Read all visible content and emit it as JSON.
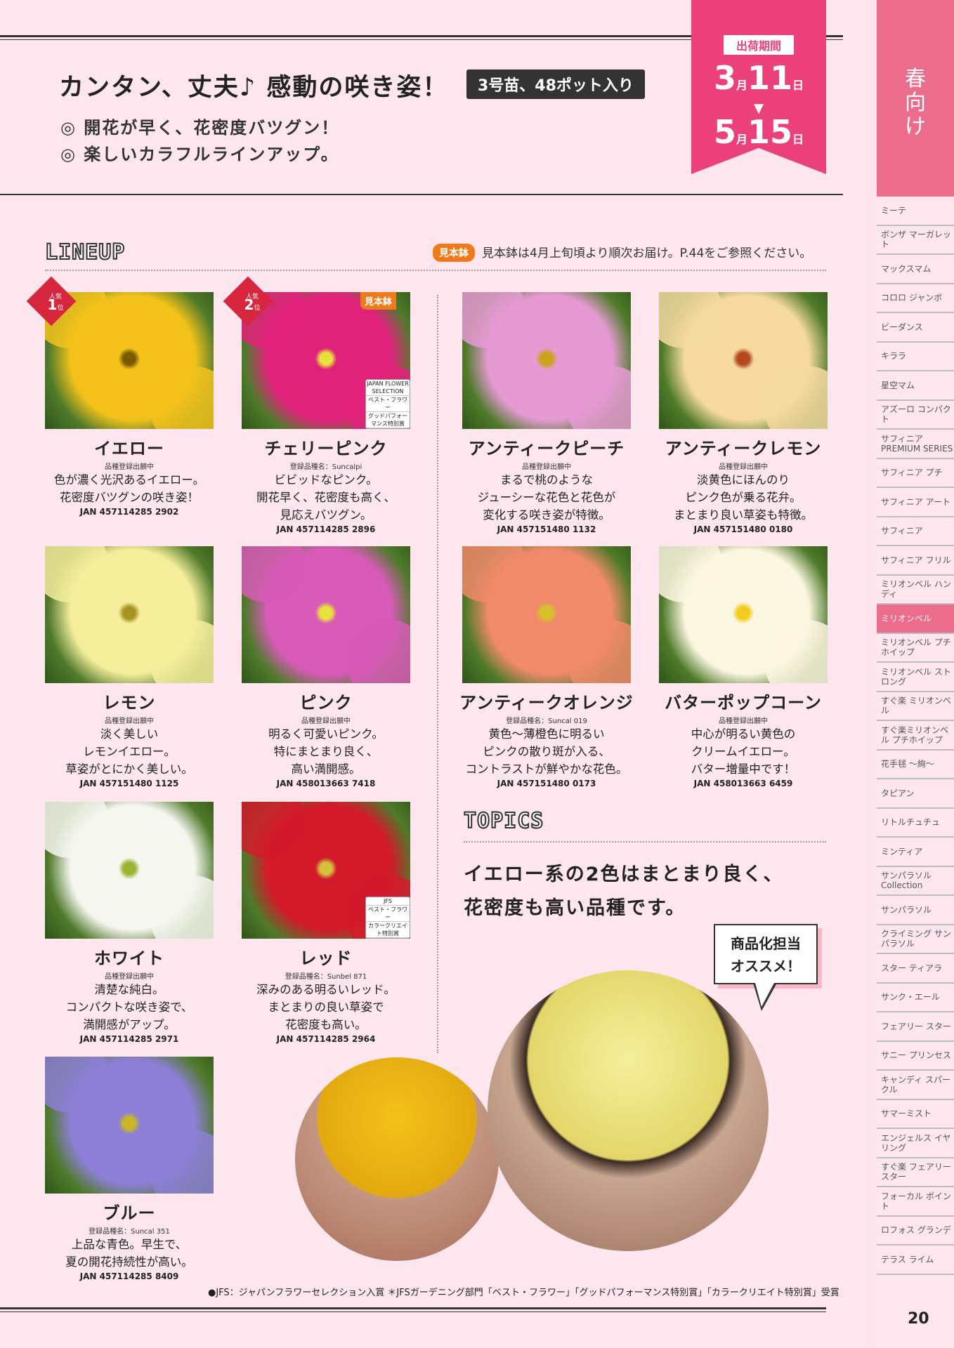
{
  "header": {
    "title": "カンタン、丈夫♪ 感動の咲き姿！",
    "pill": "3号苗、48ポット入り",
    "bullets": [
      "◎ 開花が早く、花密度バツグン！",
      "◎ 楽しいカラフルラインアップ。"
    ]
  },
  "shipping": {
    "label": "出荷期間",
    "start_month": "3",
    "start_day": "11",
    "end_month": "5",
    "end_day": "15",
    "month_unit": "月",
    "day_unit": "日",
    "arrow": "▼"
  },
  "lineup": {
    "heading": "LINEUP",
    "sample_badge": "見本鉢",
    "sample_note": "見本鉢は4月上旬頃より順次お届け。P.44をご参照ください。"
  },
  "rank": {
    "label": "人気",
    "unit": "位"
  },
  "products": [
    {
      "name": "イエロー",
      "reg": "品種登録出願中",
      "desc": [
        "色が濃く光沢あるイエロー。",
        "花密度バツグンの咲き姿！"
      ],
      "jan": "JAN 457114285 2902",
      "rank": "1",
      "color": "#f2c21b",
      "center": "#7a5a00"
    },
    {
      "name": "チェリーピンク",
      "reg": "登録品種名：Suncalpi",
      "desc": [
        "ビビッドなピンク。",
        "開花早く、花密度も高く、",
        "見応えバツグン。"
      ],
      "jan": "JAN 457114285 2896",
      "rank": "2",
      "badge": "見本鉢",
      "award": [
        "JAPAN FLOWER SELECTION",
        "ベスト・フラワー",
        "グッドパフォーマンス特別賞"
      ],
      "color": "#e0217a",
      "center": "#e8e23c"
    },
    {
      "name": "アンティークピーチ",
      "reg": "品種登録出願中",
      "desc": [
        "まるで桃のような",
        "ジューシーな花色と花色が",
        "変化する咲き姿が特徴。"
      ],
      "jan": "JAN 457151480 1132",
      "color": "#e59ad2",
      "center": "#c9a31c"
    },
    {
      "name": "アンティークレモン",
      "reg": "品種登録出願中",
      "desc": [
        "淡黄色にほんのり",
        "ピンク色が乗る花弁。",
        "まとまり良い草姿も特徴。"
      ],
      "jan": "JAN 457151480 0180",
      "color": "#f5d9a0",
      "center": "#b5461e"
    },
    {
      "name": "レモン",
      "reg": "品種登録出願中",
      "desc": [
        "淡く美しい",
        "レモンイエロー。",
        "草姿がとにかく美しい。"
      ],
      "jan": "JAN 457151480 1125",
      "color": "#f4ed9c",
      "center": "#a69420"
    },
    {
      "name": "ピンク",
      "reg": "品種登録出願中",
      "desc": [
        "明るく可愛いピンク。",
        "特にまとまり良く、",
        "高い満開感。"
      ],
      "jan": "JAN 458013663 7418",
      "color": "#d85bb7",
      "center": "#e8e23c"
    },
    {
      "name": "アンティークオレンジ",
      "reg": "登録品種名：Suncal 019",
      "desc": [
        "黄色〜薄橙色に明るい",
        "ピンクの散り斑が入る、",
        "コントラストが鮮やかな花色。"
      ],
      "jan": "JAN 457151480 0173",
      "color": "#f08a6a",
      "center": "#d8c02a"
    },
    {
      "name": "バターポップコーン",
      "reg": "品種登録出願中",
      "desc": [
        "中心が明るい黄色の",
        "クリームイエロー。",
        "バター増量中です！"
      ],
      "jan": "JAN 458013663 6459",
      "color": "#fbf6e0",
      "center": "#f2cc1a"
    },
    {
      "name": "ホワイト",
      "reg": "品種登録出願中",
      "desc": [
        "清楚な純白。",
        "コンパクトな咲き姿で、",
        "満開感がアップ。"
      ],
      "jan": "JAN 457114285 2971",
      "color": "#f6f6f0",
      "center": "#9bb532"
    },
    {
      "name": "レッド",
      "reg": "登録品種名：Sunbel 871",
      "desc": [
        "深みのある明るいレッド。",
        "まとまりの良い草姿で",
        "花密度も高い。"
      ],
      "jan": "JAN 457114285 2964",
      "award": [
        "JFS",
        "ベスト・フラワー",
        "カラークリエイト特別賞"
      ],
      "color": "#d21a2b",
      "center": "#d6c23a"
    },
    {
      "name": "ブルー",
      "reg": "登録品種名：Suncal 351",
      "desc": [
        "上品な青色。早生で、",
        "夏の開花持続性が高い。"
      ],
      "jan": "JAN 457114285 8409",
      "color": "#8d7fd6",
      "center": "#c9b625"
    }
  ],
  "topics": {
    "heading": "TOPICS",
    "lines": [
      "イエロー系の2色はまとまり良く、",
      "花密度も高い品種です。"
    ],
    "reco": [
      "商品化担当",
      "オススメ！"
    ]
  },
  "footnote": "●JFS：ジャパンフラワーセレクション入賞 ＊JFSガーデニング部門「ベスト・フラワー」「グッドパフォーマンス特別賞」「カラークリエイト特別賞」受賞",
  "sidebar": {
    "head": [
      "春",
      "向",
      "け"
    ],
    "items": [
      "ミーテ",
      "ボンザ マーガレット",
      "マックスマム",
      "コロロ ジャンボ",
      "ビーダンス",
      "キララ",
      "星空マム",
      "アズーロ コンパクト",
      "サフィニア PREMIUM SERIES",
      "サフィニア プチ",
      "サフィニア アート",
      "サフィニア",
      "サフィニア フリル",
      "ミリオンベル ハンディ",
      "ミリオンベル",
      "ミリオンベル プチホイップ",
      "ミリオンベル ストロング",
      "すぐ楽 ミリオンベル",
      "すぐ楽ミリオンベル プチホイップ",
      "花手毬 〜絢〜",
      "タピアン",
      "リトルチュチュ",
      "ミンティア",
      "サンパラソル Collection",
      "サンパラソル",
      "クライミング サンパラソル",
      "スター ティアラ",
      "サンク・エール",
      "フェアリー スター",
      "サニー プリンセス",
      "キャンディ スパークル",
      "サマーミスト",
      "エンジェルス イヤリング",
      "すぐ楽 フェアリースター",
      "フォーカル ポイント",
      "ロフォス グランデ",
      "テラス ライム"
    ],
    "active_index": 14
  },
  "page_number": "20",
  "colors": {
    "accent": "#ec407a",
    "sidebar": "#ec6c8c",
    "badge": "#f07a1a",
    "rank": "#d7263d"
  }
}
